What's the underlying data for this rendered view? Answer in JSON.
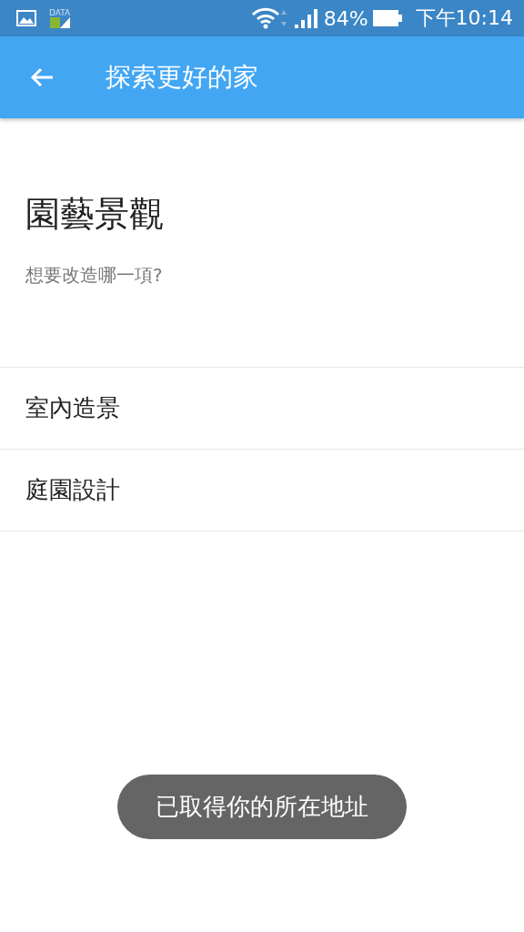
{
  "status_bar": {
    "data_label": "DATA",
    "battery": "84%",
    "time": "下午10:14"
  },
  "app_bar": {
    "title": "探索更好的家"
  },
  "heading": "園藝景觀",
  "subtitle": "想要改造哪一項?",
  "options": [
    {
      "label": "室內造景"
    },
    {
      "label": "庭園設計"
    }
  ],
  "toast": "已取得你的所在地址"
}
